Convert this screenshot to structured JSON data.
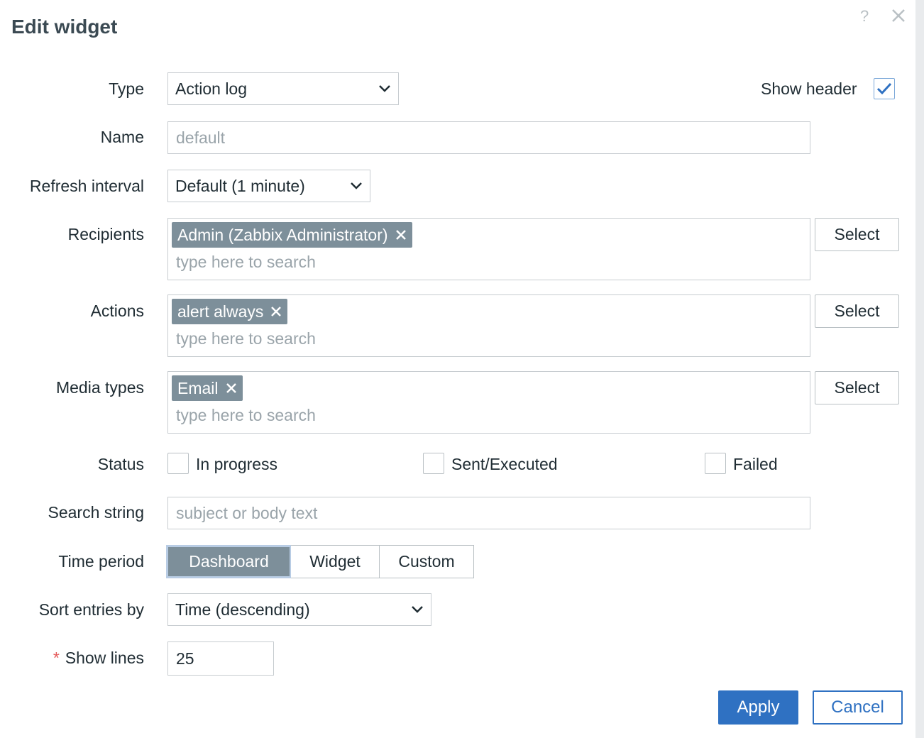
{
  "dialog": {
    "title": "Edit widget",
    "help_icon": "?",
    "close_icon": "close-icon"
  },
  "form": {
    "type": {
      "label": "Type",
      "value": "Action log"
    },
    "show_header": {
      "label": "Show header",
      "checked": true
    },
    "name": {
      "label": "Name",
      "placeholder": "default"
    },
    "refresh_interval": {
      "label": "Refresh interval",
      "value": "Default (1 minute)"
    },
    "recipients": {
      "label": "Recipients",
      "chips": [
        "Admin (Zabbix Administrator)"
      ],
      "placeholder": "type here to search",
      "select_label": "Select"
    },
    "actions": {
      "label": "Actions",
      "chips": [
        "alert always"
      ],
      "placeholder": "type here to search",
      "select_label": "Select"
    },
    "media_types": {
      "label": "Media types",
      "chips": [
        "Email"
      ],
      "placeholder": "type here to search",
      "select_label": "Select"
    },
    "status": {
      "label": "Status",
      "options": [
        {
          "label": "In progress",
          "checked": false
        },
        {
          "label": "Sent/Executed",
          "checked": false
        },
        {
          "label": "Failed",
          "checked": false
        }
      ]
    },
    "search_string": {
      "label": "Search string",
      "placeholder": "subject or body text"
    },
    "time_period": {
      "label": "Time period",
      "options": [
        "Dashboard",
        "Widget",
        "Custom"
      ],
      "selected": "Dashboard"
    },
    "sort_entries_by": {
      "label": "Sort entries by",
      "value": "Time (descending)"
    },
    "show_lines": {
      "label": "Show lines",
      "required_marker": "*",
      "value": "25"
    }
  },
  "footer": {
    "apply_label": "Apply",
    "cancel_label": "Cancel"
  },
  "colors": {
    "accent": "#2f71c2",
    "chip_bg": "#7d8f9a",
    "border": "#c7ccd0",
    "required": "#e45959"
  }
}
